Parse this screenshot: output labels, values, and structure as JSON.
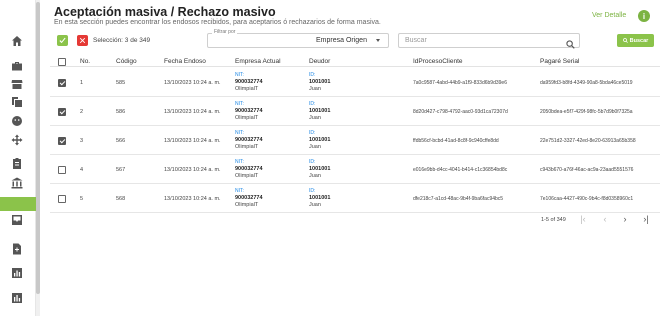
{
  "header": {
    "title": "Aceptación masiva / Rechazo masivo",
    "subtitle": "En esta sección puedes encontrar los endosos recibidos, para aceptarios ó rechazarios de forma masiva.",
    "ver_detalle": "Ver Detalle",
    "info": "i"
  },
  "toolbar": {
    "selection": "Selección: 3 de 349",
    "filter_legend": "Filtrar por",
    "filter_value": "Empresa Origen",
    "search_placeholder": "Buscar",
    "search_button": "Buscar"
  },
  "table": {
    "headers": [
      "No.",
      "Código",
      "Fecha Endoso",
      "Empresa Actual",
      "Deudor",
      "IdProcesoCliente",
      "Pagaré Serial"
    ],
    "nit_label": "NIT:",
    "id_label": "ID:",
    "rows": [
      {
        "no": "1",
        "codigo": "585",
        "fecha": "13/10/2023 10:24 a. m.",
        "nit": "900032774",
        "empresa": "OlimpialT",
        "deudor_id": "1001001",
        "deudor": "Juan",
        "proceso": "7a0c9587-4abd-44b9-a1f9-833d6b9d39e6",
        "serial": "da959fd3-b8fd-4349-90a8-5bda46ce5019",
        "checked": true
      },
      {
        "no": "2",
        "codigo": "586",
        "fecha": "13/10/2023 10:24 a. m.",
        "nit": "900032774",
        "empresa": "OlimpialT",
        "deudor_id": "1001001",
        "deudor": "Juan",
        "proceso": "8d20d427-c798-4792-aac0-93d1ca72307d",
        "serial": "2050bdea-e5f7-429f-98fc-5b7d9b0f7325a",
        "checked": true
      },
      {
        "no": "3",
        "codigo": "566",
        "fecha": "13/10/2023 10:24 a. m.",
        "nit": "900032774",
        "empresa": "OlimpialT",
        "deudor_id": "1001001",
        "deudor": "Juan",
        "proceso": "ffdb56cf-bcbd-41ad-8c8f-9c940cffe8dd",
        "serial": "22e751d2-3327-42ed-8e20-63913a65b358",
        "checked": true
      },
      {
        "no": "4",
        "codigo": "567",
        "fecha": "13/10/2023 10:24 a. m.",
        "nit": "900032774",
        "empresa": "OlimpialT",
        "deudor_id": "1001001",
        "deudor": "Juan",
        "proceso": "e016e9bb-d4cc-4041-b414-c1c36854bd8c",
        "serial": "c943b670-a76f-46ac-ac9a-23aad5551576",
        "checked": false
      },
      {
        "no": "5",
        "codigo": "568",
        "fecha": "13/10/2023 10:24 a. m.",
        "nit": "900032774",
        "empresa": "OlimpialT",
        "deudor_id": "1001001",
        "deudor": "Juan",
        "proceso": "dfe218c7-a1cd-48ac-9b4f-9ba6fac94bc5",
        "serial": "7e106caa-4427-490c-9b4c-f8d0358960c1",
        "checked": false
      }
    ]
  },
  "pagination": {
    "text": "1-5 of 349",
    "first": "|‹",
    "prev": "‹",
    "next": "›",
    "last": "›|"
  },
  "colors": {
    "accent": "#8bc34a",
    "danger": "#e53935",
    "label": "#1e88e5"
  }
}
